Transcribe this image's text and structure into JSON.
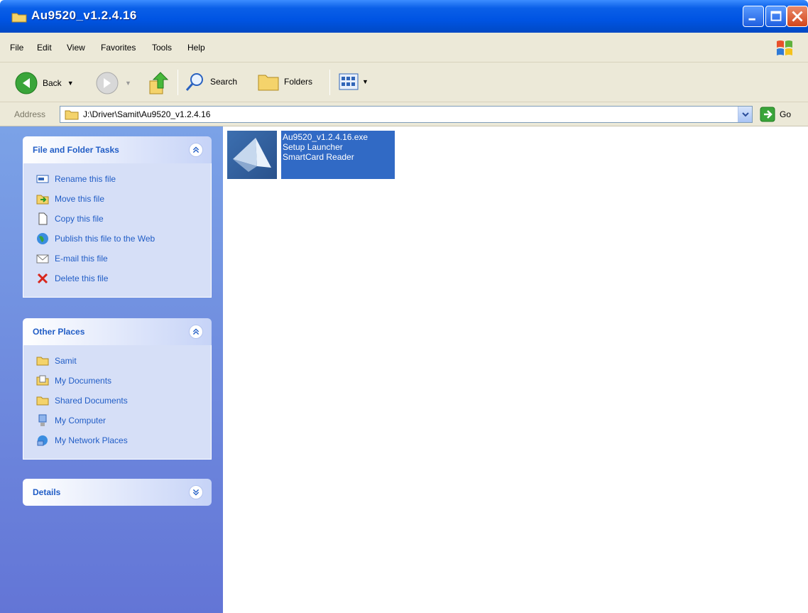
{
  "window": {
    "title": "Au9520_v1.2.4.16"
  },
  "menu": [
    "File",
    "Edit",
    "View",
    "Favorites",
    "Tools",
    "Help"
  ],
  "toolbar": {
    "back": "Back",
    "search": "Search",
    "folders": "Folders"
  },
  "address": {
    "label": "Address",
    "path": "J:\\Driver\\Samit\\Au9520_v1.2.4.16",
    "go": "Go"
  },
  "tasks": {
    "title": "File and Folder Tasks",
    "items": [
      "Rename this file",
      "Move this file",
      "Copy this file",
      "Publish this file to the Web",
      "E-mail this file",
      "Delete this file"
    ]
  },
  "places": {
    "title": "Other Places",
    "items": [
      "Samit",
      "My Documents",
      "Shared Documents",
      "My Computer",
      "My Network Places"
    ]
  },
  "details": {
    "title": "Details"
  },
  "file": {
    "name": "Au9520_v1.2.4.16.exe",
    "desc1": "Setup Launcher",
    "desc2": "SmartCard Reader"
  },
  "colors": {
    "title_blue": "#0054e3",
    "task_text": "#215dc6",
    "selection": "#316ac5",
    "pane_top": "#7ba2e7"
  }
}
